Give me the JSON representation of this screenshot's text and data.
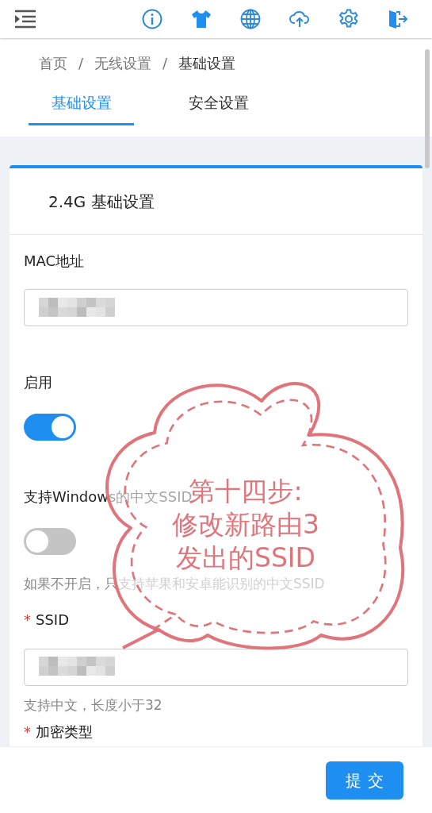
{
  "breadcrumb": {
    "separator": "/",
    "items": [
      "首页",
      "无线设置",
      "基础设置"
    ]
  },
  "tabs": [
    {
      "label": "基础设置",
      "selected": true
    },
    {
      "label": "安全设置",
      "selected": false
    }
  ],
  "card": {
    "title": "2.4G 基础设置",
    "required_mark": "*",
    "fields": [
      {
        "kind": "input",
        "label": "MAC地址",
        "required": false
      },
      {
        "kind": "switch",
        "label": "启用",
        "on": true
      },
      {
        "kind": "switch",
        "label": "支持Windows的中文SSID",
        "on": false,
        "hint": "如果不开启，只支持苹果和安卓能识别的中文SSID"
      },
      {
        "kind": "input",
        "label": "SSID",
        "required": true,
        "hint": "支持中文，长度小于32"
      },
      {
        "kind": "label",
        "label": "加密类型",
        "required": true
      }
    ]
  },
  "submit": "提交",
  "annotation": {
    "lines": [
      "第十四步:",
      "修改新路由3",
      "发出的SSID"
    ]
  }
}
